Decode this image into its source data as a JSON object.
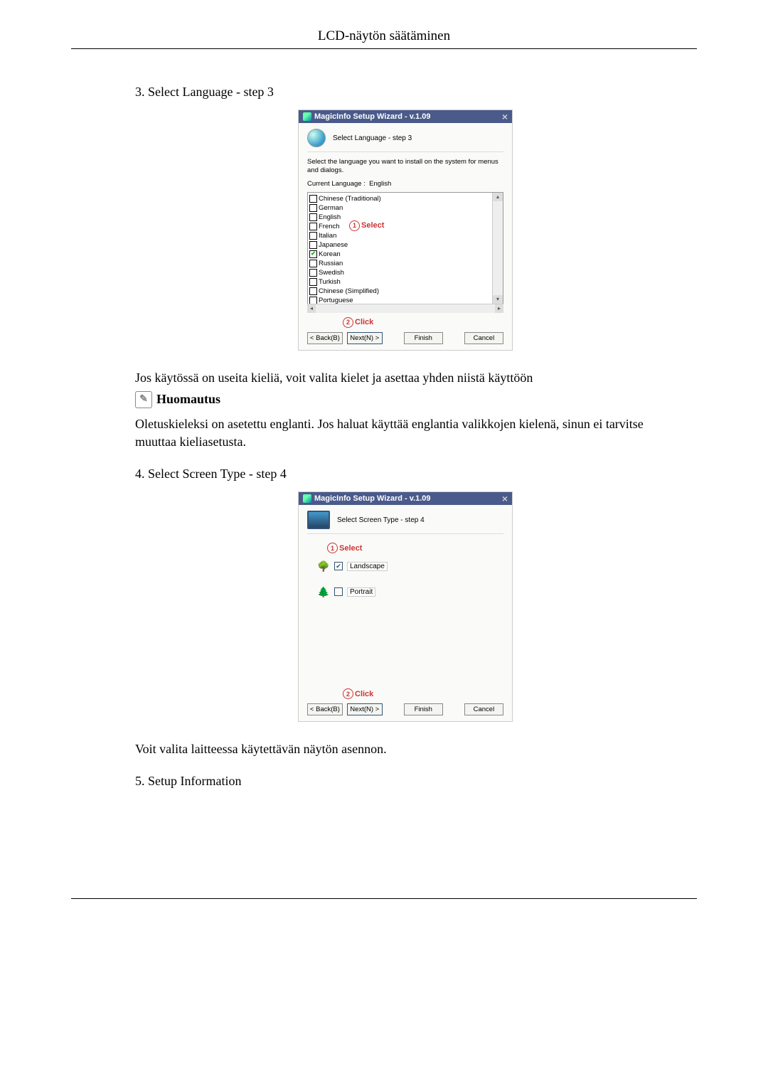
{
  "header": {
    "title": "LCD-näytön säätäminen"
  },
  "steps": {
    "s3": {
      "title": "3. Select Language - step 3"
    },
    "s4": {
      "title": "4. Select Screen Type - step 4"
    },
    "s5": {
      "title": "5. Setup Information"
    }
  },
  "dialog_common": {
    "window_title": "MagicInfo Setup Wizard - v.1.09",
    "buttons": {
      "back": "< Back(B)",
      "next": "Next(N) >",
      "finish": "Finish",
      "cancel": "Cancel"
    },
    "callout_select": "Select",
    "callout_click": "Click"
  },
  "dialog3": {
    "header": "Select Language - step 3",
    "instruction": "Select the language you want to install on the system for menus and dialogs.",
    "current_label": "Current Language  :",
    "current_value": "English",
    "languages": [
      {
        "label": "Chinese (Traditional)",
        "checked": false
      },
      {
        "label": "German",
        "checked": false
      },
      {
        "label": "English",
        "checked": false
      },
      {
        "label": "French",
        "checked": false
      },
      {
        "label": "Italian",
        "checked": false
      },
      {
        "label": "Japanese",
        "checked": false
      },
      {
        "label": "Korean",
        "checked": true
      },
      {
        "label": "Russian",
        "checked": false
      },
      {
        "label": "Swedish",
        "checked": false
      },
      {
        "label": "Turkish",
        "checked": false
      },
      {
        "label": "Chinese (Simplified)",
        "checked": false
      },
      {
        "label": "Portuguese",
        "checked": false
      }
    ]
  },
  "text": {
    "after3": "Jos käytössä on useita kieliä, voit valita kielet ja asettaa yhden niistä käyttöön",
    "note_label": "Huomautus",
    "note_body": "Oletuskieleksi on asetettu englanti. Jos haluat käyttää englantia valikkojen kielenä, sinun ei tarvitse muuttaa kieliasetusta.",
    "after4": "Voit valita laitteessa käytettävän näytön asennon."
  },
  "dialog4": {
    "header": "Select Screen Type - step 4",
    "options": [
      {
        "label": "Landscape",
        "checked": true
      },
      {
        "label": "Portrait",
        "checked": false
      }
    ]
  }
}
